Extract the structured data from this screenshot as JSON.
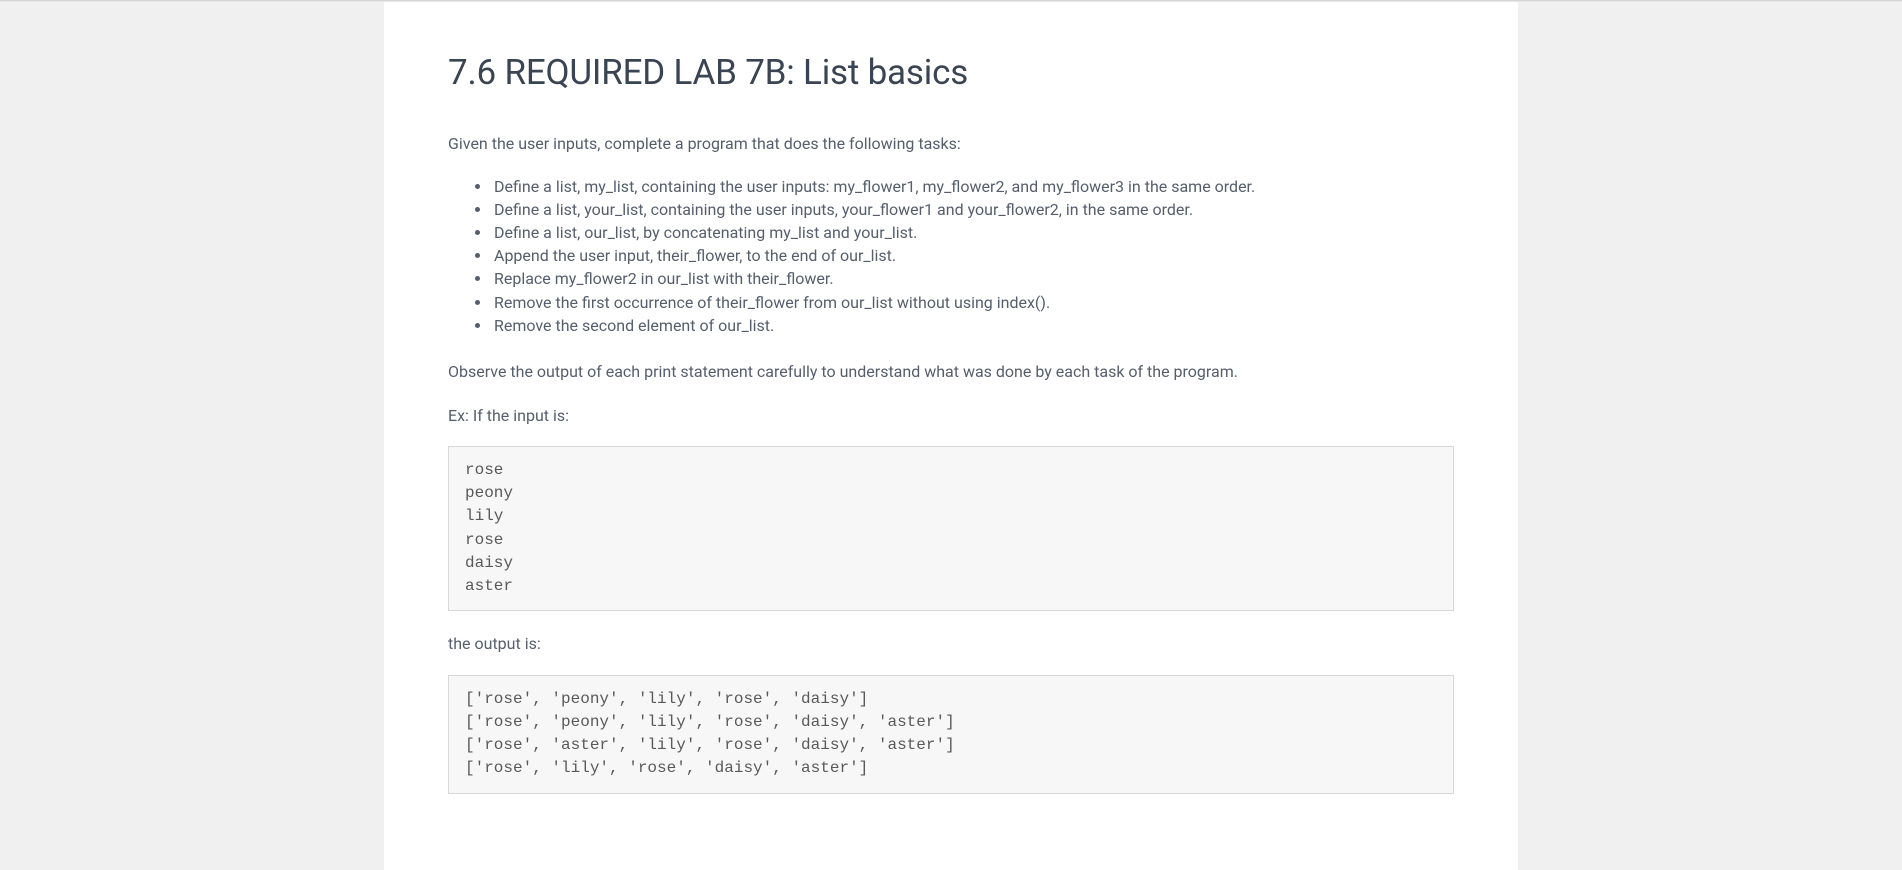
{
  "title": "7.6 REQUIRED LAB 7B: List basics",
  "intro": "Given the user inputs, complete a program that does the following tasks:",
  "tasks": [
    "Define a list, my_list, containing the user inputs: my_flower1, my_flower2, and my_flower3 in the same order.",
    "Define a list, your_list, containing the user inputs, your_flower1 and your_flower2, in the same order.",
    "Define a list, our_list, by concatenating my_list and your_list.",
    "Append the user input, their_flower, to the end of our_list.",
    "Replace my_flower2 in our_list with their_flower.",
    "Remove the first occurrence of their_flower from our_list without using index().",
    "Remove the second element of our_list."
  ],
  "observe": "Observe the output of each print statement carefully to understand what was done by each task of the program.",
  "exInputLabel": "Ex: If the input is:",
  "exInput": "rose\npeony\nlily\nrose\ndaisy\naster",
  "outputLabel": "the output is:",
  "exOutput": "['rose', 'peony', 'lily', 'rose', 'daisy']\n['rose', 'peony', 'lily', 'rose', 'daisy', 'aster']\n['rose', 'aster', 'lily', 'rose', 'daisy', 'aster']\n['rose', 'lily', 'rose', 'daisy', 'aster']"
}
